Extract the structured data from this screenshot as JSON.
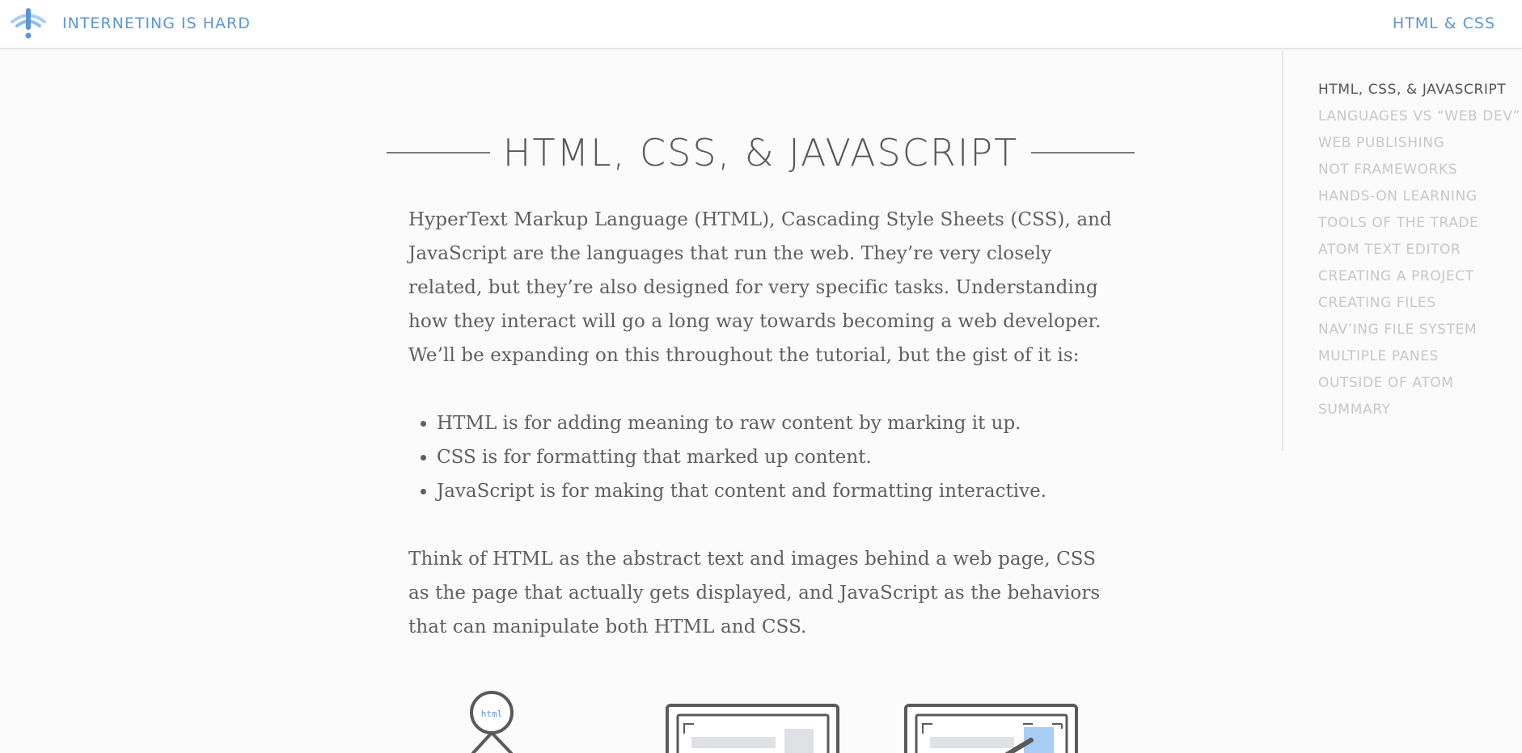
{
  "header": {
    "site_title": "Interneting is Hard",
    "nav_link": "HTML & CSS"
  },
  "main": {
    "title": "HTML, CSS, & JavaScript",
    "intro": "HyperText Markup Language (HTML), Cascading Style Sheets (CSS), and JavaScript are the languages that run the web. They’re very closely related, but they’re also designed for very specific tasks. Understanding how they interact will go a long way towards becoming a web developer. We’ll be expanding on this throughout the tutorial, but the gist of it is:",
    "bullets": [
      "HTML is for adding meaning to raw content by marking it up.",
      "CSS is for formatting that marked up content.",
      "JavaScript is for making that content and formatting interactive."
    ],
    "outro": "Think of HTML as the abstract text and images behind a web page, CSS as the page that actually gets displayed, and JavaScript as the behaviors that can manipulate both HTML and CSS.",
    "illustration_label": "html"
  },
  "toc": {
    "items": [
      "HTML, CSS, & JavaScript",
      "Languages vs “Web Dev”",
      "Web Publishing",
      "Not Frameworks",
      "Hands-on Learning",
      "Tools of the Trade",
      "Atom Text Editor",
      "Creating a Project",
      "Creating Files",
      "Nav’ing File System",
      "Multiple Panes",
      "Outside of Atom",
      "Summary"
    ],
    "active_index": 0
  },
  "colors": {
    "accent": "#5a96d6",
    "text": "#5f5f5f",
    "toc_inactive": "#c7c7c7",
    "highlight": "#a9cdf5"
  },
  "icons": {
    "logo": "interneting-is-hard-logo-icon"
  }
}
